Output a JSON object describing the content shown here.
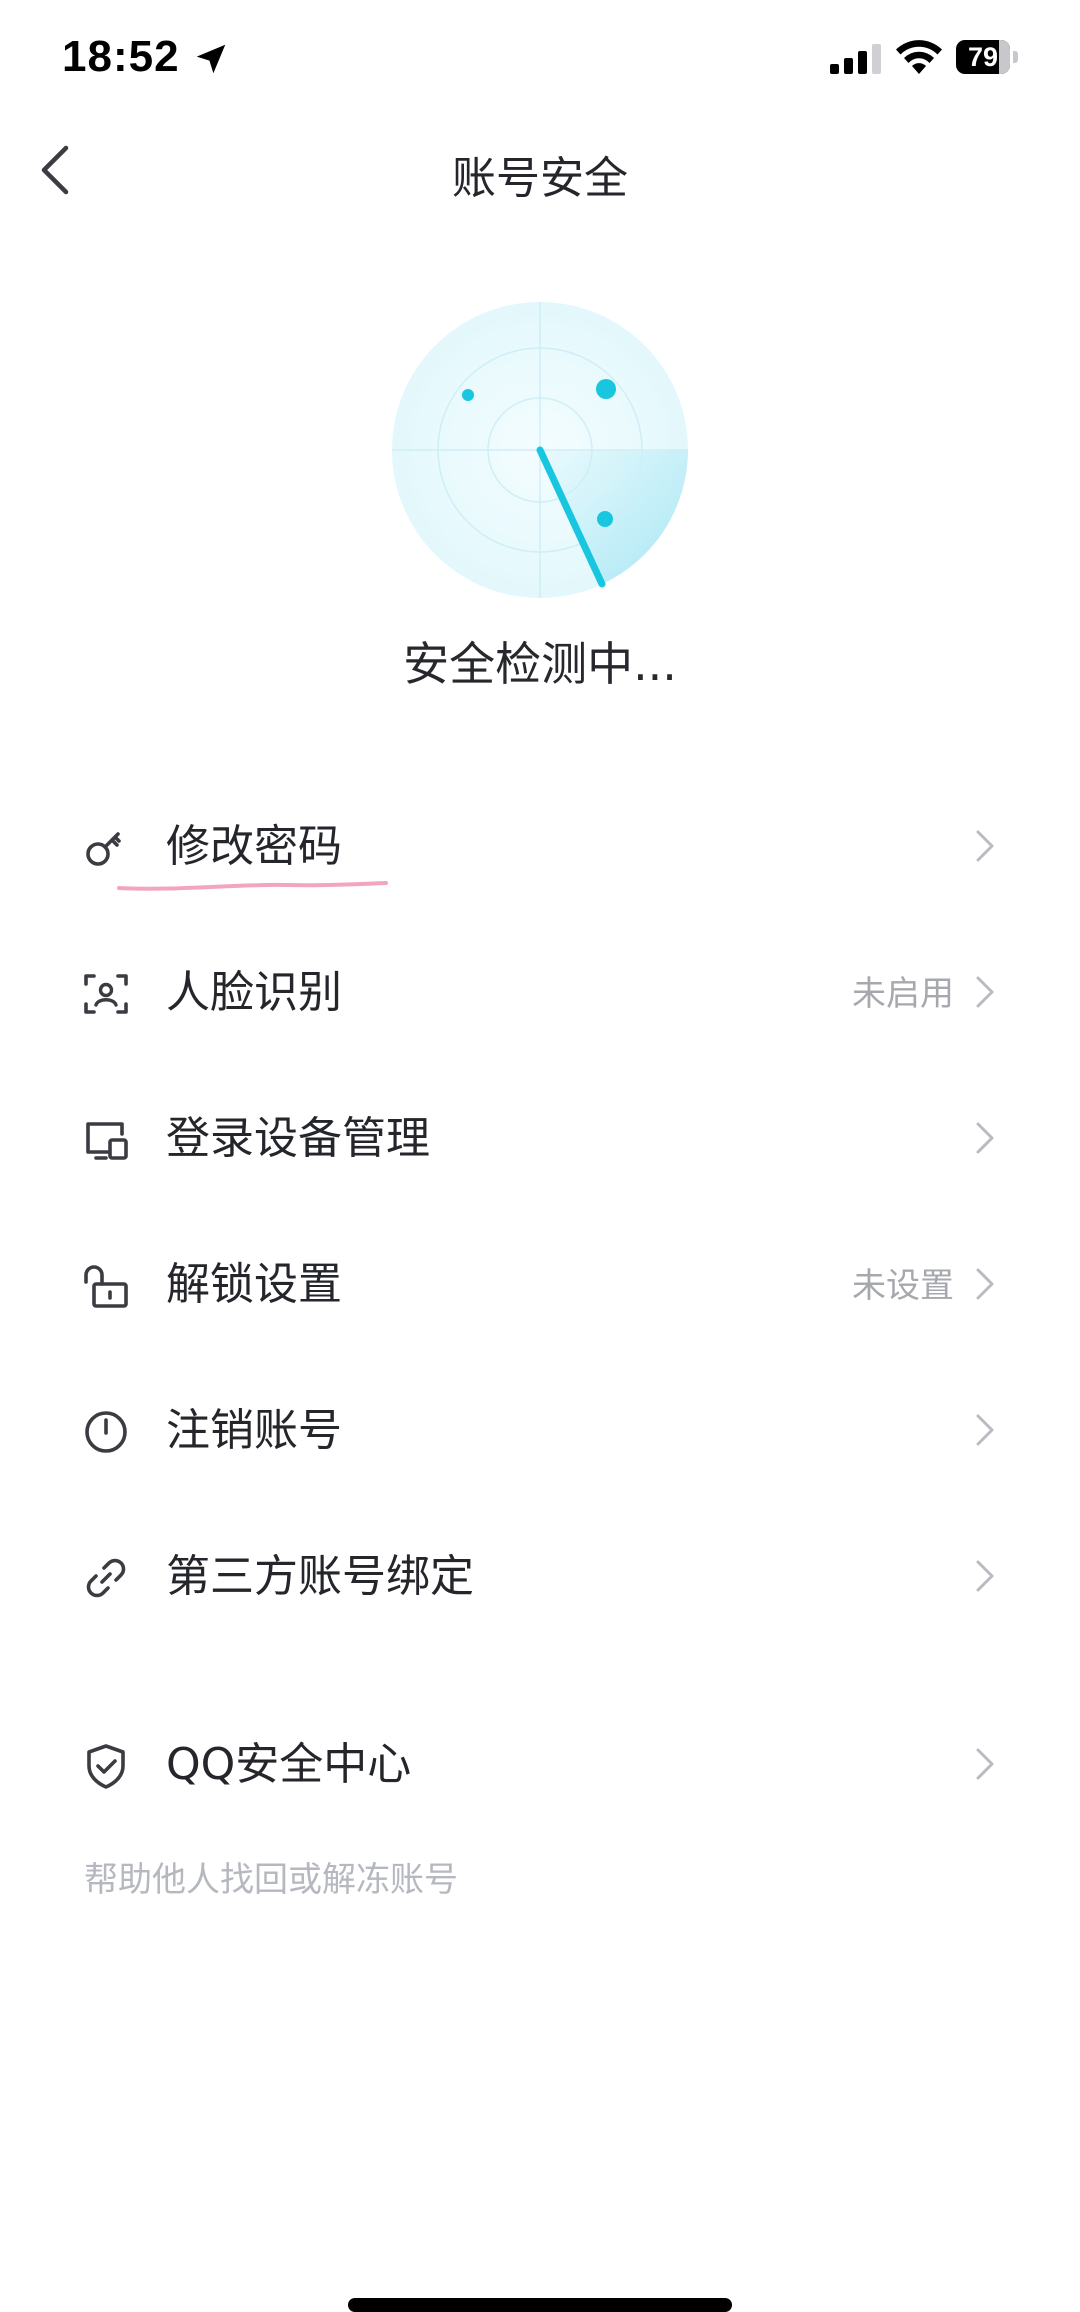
{
  "status_bar": {
    "time": "18:52",
    "battery_level": "79",
    "battery_fraction": 0.79
  },
  "nav": {
    "title": "账号安全",
    "back_icon": "chevron-left-icon"
  },
  "scan": {
    "status_text": "安全检测中..."
  },
  "menu": {
    "items": [
      {
        "label": "修改密码",
        "status": "",
        "icon": "key-icon"
      },
      {
        "label": "人脸识别",
        "status": "未启用",
        "icon": "face-scan-icon"
      },
      {
        "label": "登录设备管理",
        "status": "",
        "icon": "devices-icon"
      },
      {
        "label": "解锁设置",
        "status": "未设置",
        "icon": "unlock-icon"
      },
      {
        "label": "注销账号",
        "status": "",
        "icon": "power-icon"
      },
      {
        "label": "第三方账号绑定",
        "status": "",
        "icon": "link-icon"
      }
    ],
    "security_center": {
      "label": "QQ安全中心",
      "icon": "shield-check-icon"
    }
  },
  "footer": {
    "help_link": "帮助他人找回或解冻账号"
  },
  "colors": {
    "accent": "#1ec8e0",
    "text_primary": "#24262b",
    "text_secondary": "#a6a8ae",
    "annotation_pink": "#f3a5c0"
  }
}
